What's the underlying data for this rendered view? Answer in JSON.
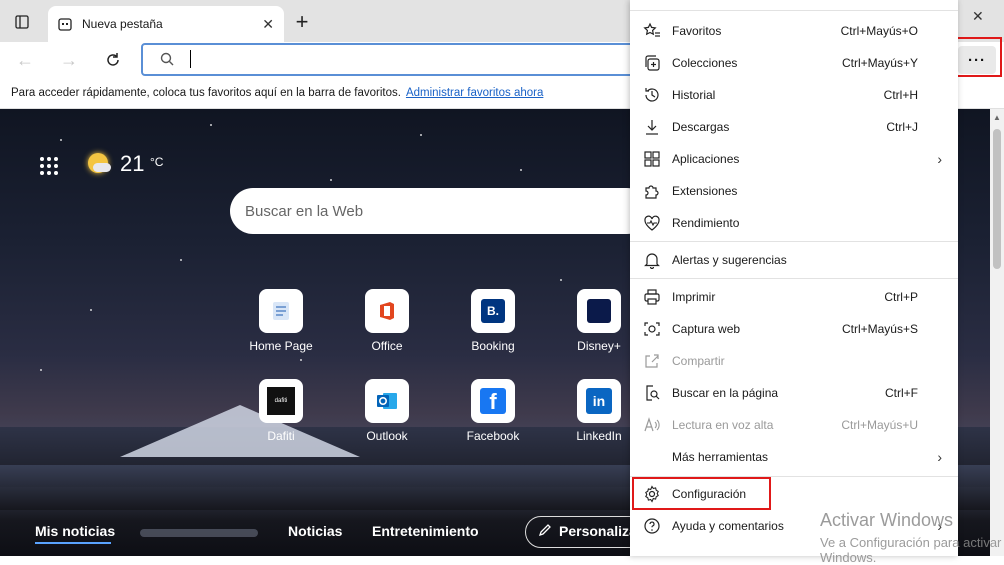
{
  "tab": {
    "title": "Nueva pestaña"
  },
  "favbar": {
    "text": "Para acceder rápidamente, coloca tus favoritos aquí en la barra de favoritos.",
    "link": "Administrar favoritos ahora"
  },
  "newtab": {
    "temperature": "21",
    "temp_unit": "°C",
    "search_placeholder": "Buscar en la Web",
    "quick_links": [
      {
        "label": "Home Page",
        "icon": "home-page-icon"
      },
      {
        "label": "Office",
        "icon": "office-icon"
      },
      {
        "label": "Booking",
        "icon": "booking-icon",
        "glyph": "B."
      },
      {
        "label": "Disney+",
        "icon": "disney-plus-icon"
      },
      {
        "label": "Dafiti",
        "icon": "dafiti-icon",
        "glyph": "dafiti"
      },
      {
        "label": "Outlook",
        "icon": "outlook-icon"
      },
      {
        "label": "Facebook",
        "icon": "facebook-icon",
        "glyph": "f"
      },
      {
        "label": "LinkedIn",
        "icon": "linkedin-icon",
        "glyph": "in"
      }
    ],
    "news_tabs": [
      "Mis noticias",
      "Noticias",
      "Entretenimiento"
    ],
    "personalize": "Personaliza"
  },
  "menu": {
    "items": [
      {
        "label": "Favoritos",
        "shortcut": "Ctrl+Mayús+O",
        "icon": "star-list-icon"
      },
      {
        "label": "Colecciones",
        "shortcut": "Ctrl+Mayús+Y",
        "icon": "collections-icon"
      },
      {
        "label": "Historial",
        "shortcut": "Ctrl+H",
        "icon": "history-icon"
      },
      {
        "label": "Descargas",
        "shortcut": "Ctrl+J",
        "icon": "download-icon"
      },
      {
        "label": "Aplicaciones",
        "shortcut": "",
        "icon": "apps-icon",
        "submenu": true
      },
      {
        "label": "Extensiones",
        "shortcut": "",
        "icon": "extensions-icon"
      },
      {
        "label": "Rendimiento",
        "shortcut": "",
        "icon": "performance-icon"
      },
      {
        "label": "Alertas y sugerencias",
        "shortcut": "",
        "icon": "bell-icon"
      },
      {
        "label": "Imprimir",
        "shortcut": "Ctrl+P",
        "icon": "print-icon"
      },
      {
        "label": "Captura web",
        "shortcut": "Ctrl+Mayús+S",
        "icon": "web-capture-icon"
      },
      {
        "label": "Compartir",
        "shortcut": "",
        "icon": "share-icon",
        "disabled": true
      },
      {
        "label": "Buscar en la página",
        "shortcut": "Ctrl+F",
        "icon": "find-icon"
      },
      {
        "label": "Lectura en voz alta",
        "shortcut": "Ctrl+Mayús+U",
        "icon": "read-aloud-icon",
        "disabled": true
      },
      {
        "label": "Más herramientas",
        "shortcut": "",
        "icon": "",
        "submenu": true
      },
      {
        "label": "Configuración",
        "shortcut": "",
        "icon": "settings-icon",
        "highlighted": true
      },
      {
        "label": "Ayuda y comentarios",
        "shortcut": "",
        "icon": "help-icon",
        "submenu": true
      }
    ]
  },
  "watermark": {
    "line1": "Activar Windows",
    "line2": "Ve a Configuración para activar Windows."
  },
  "colors": {
    "highlight": "#e01919",
    "address_border": "#5a8fd6",
    "link": "#1a62c7"
  }
}
